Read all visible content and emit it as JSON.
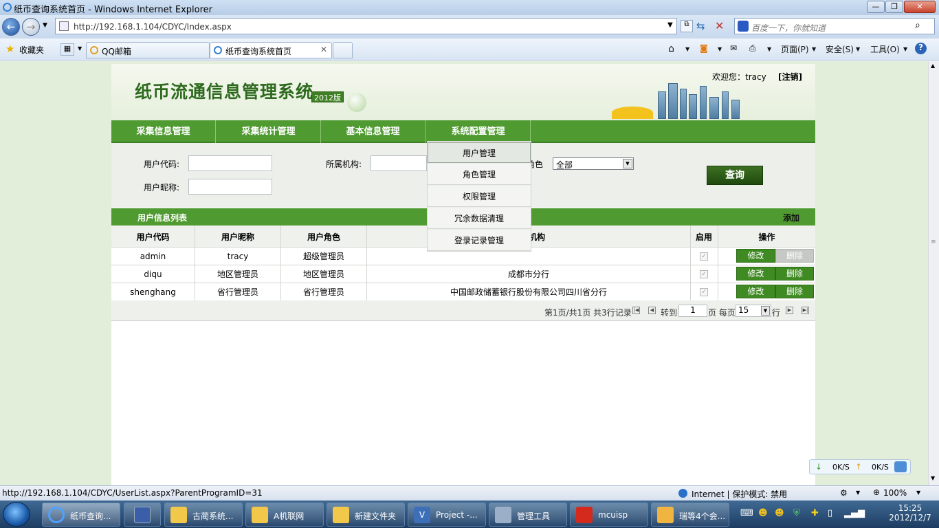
{
  "window": {
    "title": "纸币查询系统首页 - Windows Internet Explorer"
  },
  "address": {
    "url": "http://192.168.1.104/CDYC/Index.aspx",
    "search_placeholder": "百度一下，你就知道"
  },
  "favorites": {
    "label": "收藏夹",
    "tabs": [
      {
        "label": "QQ邮箱"
      },
      {
        "label": "纸币查询系统首页"
      }
    ]
  },
  "toolbar": {
    "page": "页面(P)",
    "safety": "安全(S)",
    "tools": "工具(O)"
  },
  "site": {
    "title": "纸币流通信息管理系统",
    "version": "2012版",
    "welcome": "欢迎您：tracy",
    "logout": "[注销]"
  },
  "nav": {
    "items": [
      {
        "label": "采集信息管理"
      },
      {
        "label": "采集统计管理"
      },
      {
        "label": "基本信息管理"
      },
      {
        "label": "系统配置管理"
      }
    ]
  },
  "dropdown": {
    "items": [
      {
        "label": "用户管理"
      },
      {
        "label": "角色管理"
      },
      {
        "label": "权限管理"
      },
      {
        "label": "冗余数据清理"
      },
      {
        "label": "登录记录管理"
      }
    ]
  },
  "search": {
    "user_code_label": "用户代码:",
    "user_nick_label": "用户昵称:",
    "org_label": "所属机构:",
    "role_label": "角色:",
    "role_value": "全部",
    "query_button": "查询"
  },
  "list": {
    "title": "用户信息列表",
    "add": "添加",
    "columns": {
      "code": "用户代码",
      "nick": "用户昵称",
      "role": "用户角色",
      "org": "所属机构",
      "enabled": "启用",
      "ops": "操作"
    },
    "rows": [
      {
        "code": "admin",
        "nick": "tracy",
        "role": "超级管理员",
        "org": "",
        "edit": "修改",
        "delete": "删除",
        "delete_enabled": false
      },
      {
        "code": "diqu",
        "nick": "地区管理员",
        "role": "地区管理员",
        "org": "成都市分行",
        "edit": "修改",
        "delete": "删除",
        "delete_enabled": true
      },
      {
        "code": "shenghang",
        "nick": "省行管理员",
        "role": "省行管理员",
        "org": "中国邮政储蓄银行股份有限公司四川省分行",
        "edit": "修改",
        "delete": "删除",
        "delete_enabled": true
      }
    ]
  },
  "pager": {
    "info": "第1页/共1页 共3行记录",
    "goto": "转到",
    "page_input": "1",
    "page_unit": "页 每页",
    "page_size": "15",
    "row_unit": "行"
  },
  "statusbar": {
    "url": "http://192.168.1.104/CDYC/UserList.aspx?ParentProgramID=31",
    "zone": "Internet | 保护模式: 禁用",
    "zoom": "100%"
  },
  "netspeed": {
    "down": "0K/S",
    "up": "0K/S"
  },
  "taskbar": {
    "items": [
      {
        "label": "纸币查询..."
      },
      {
        "label": "古蔺系统..."
      },
      {
        "label": "A机联网"
      },
      {
        "label": "新建文件夹"
      },
      {
        "label": "Project -..."
      },
      {
        "label": "管理工具"
      },
      {
        "label": "mcuisp"
      },
      {
        "label": "瑞等4个会..."
      }
    ],
    "time": "15:25",
    "date": "2012/12/7"
  }
}
